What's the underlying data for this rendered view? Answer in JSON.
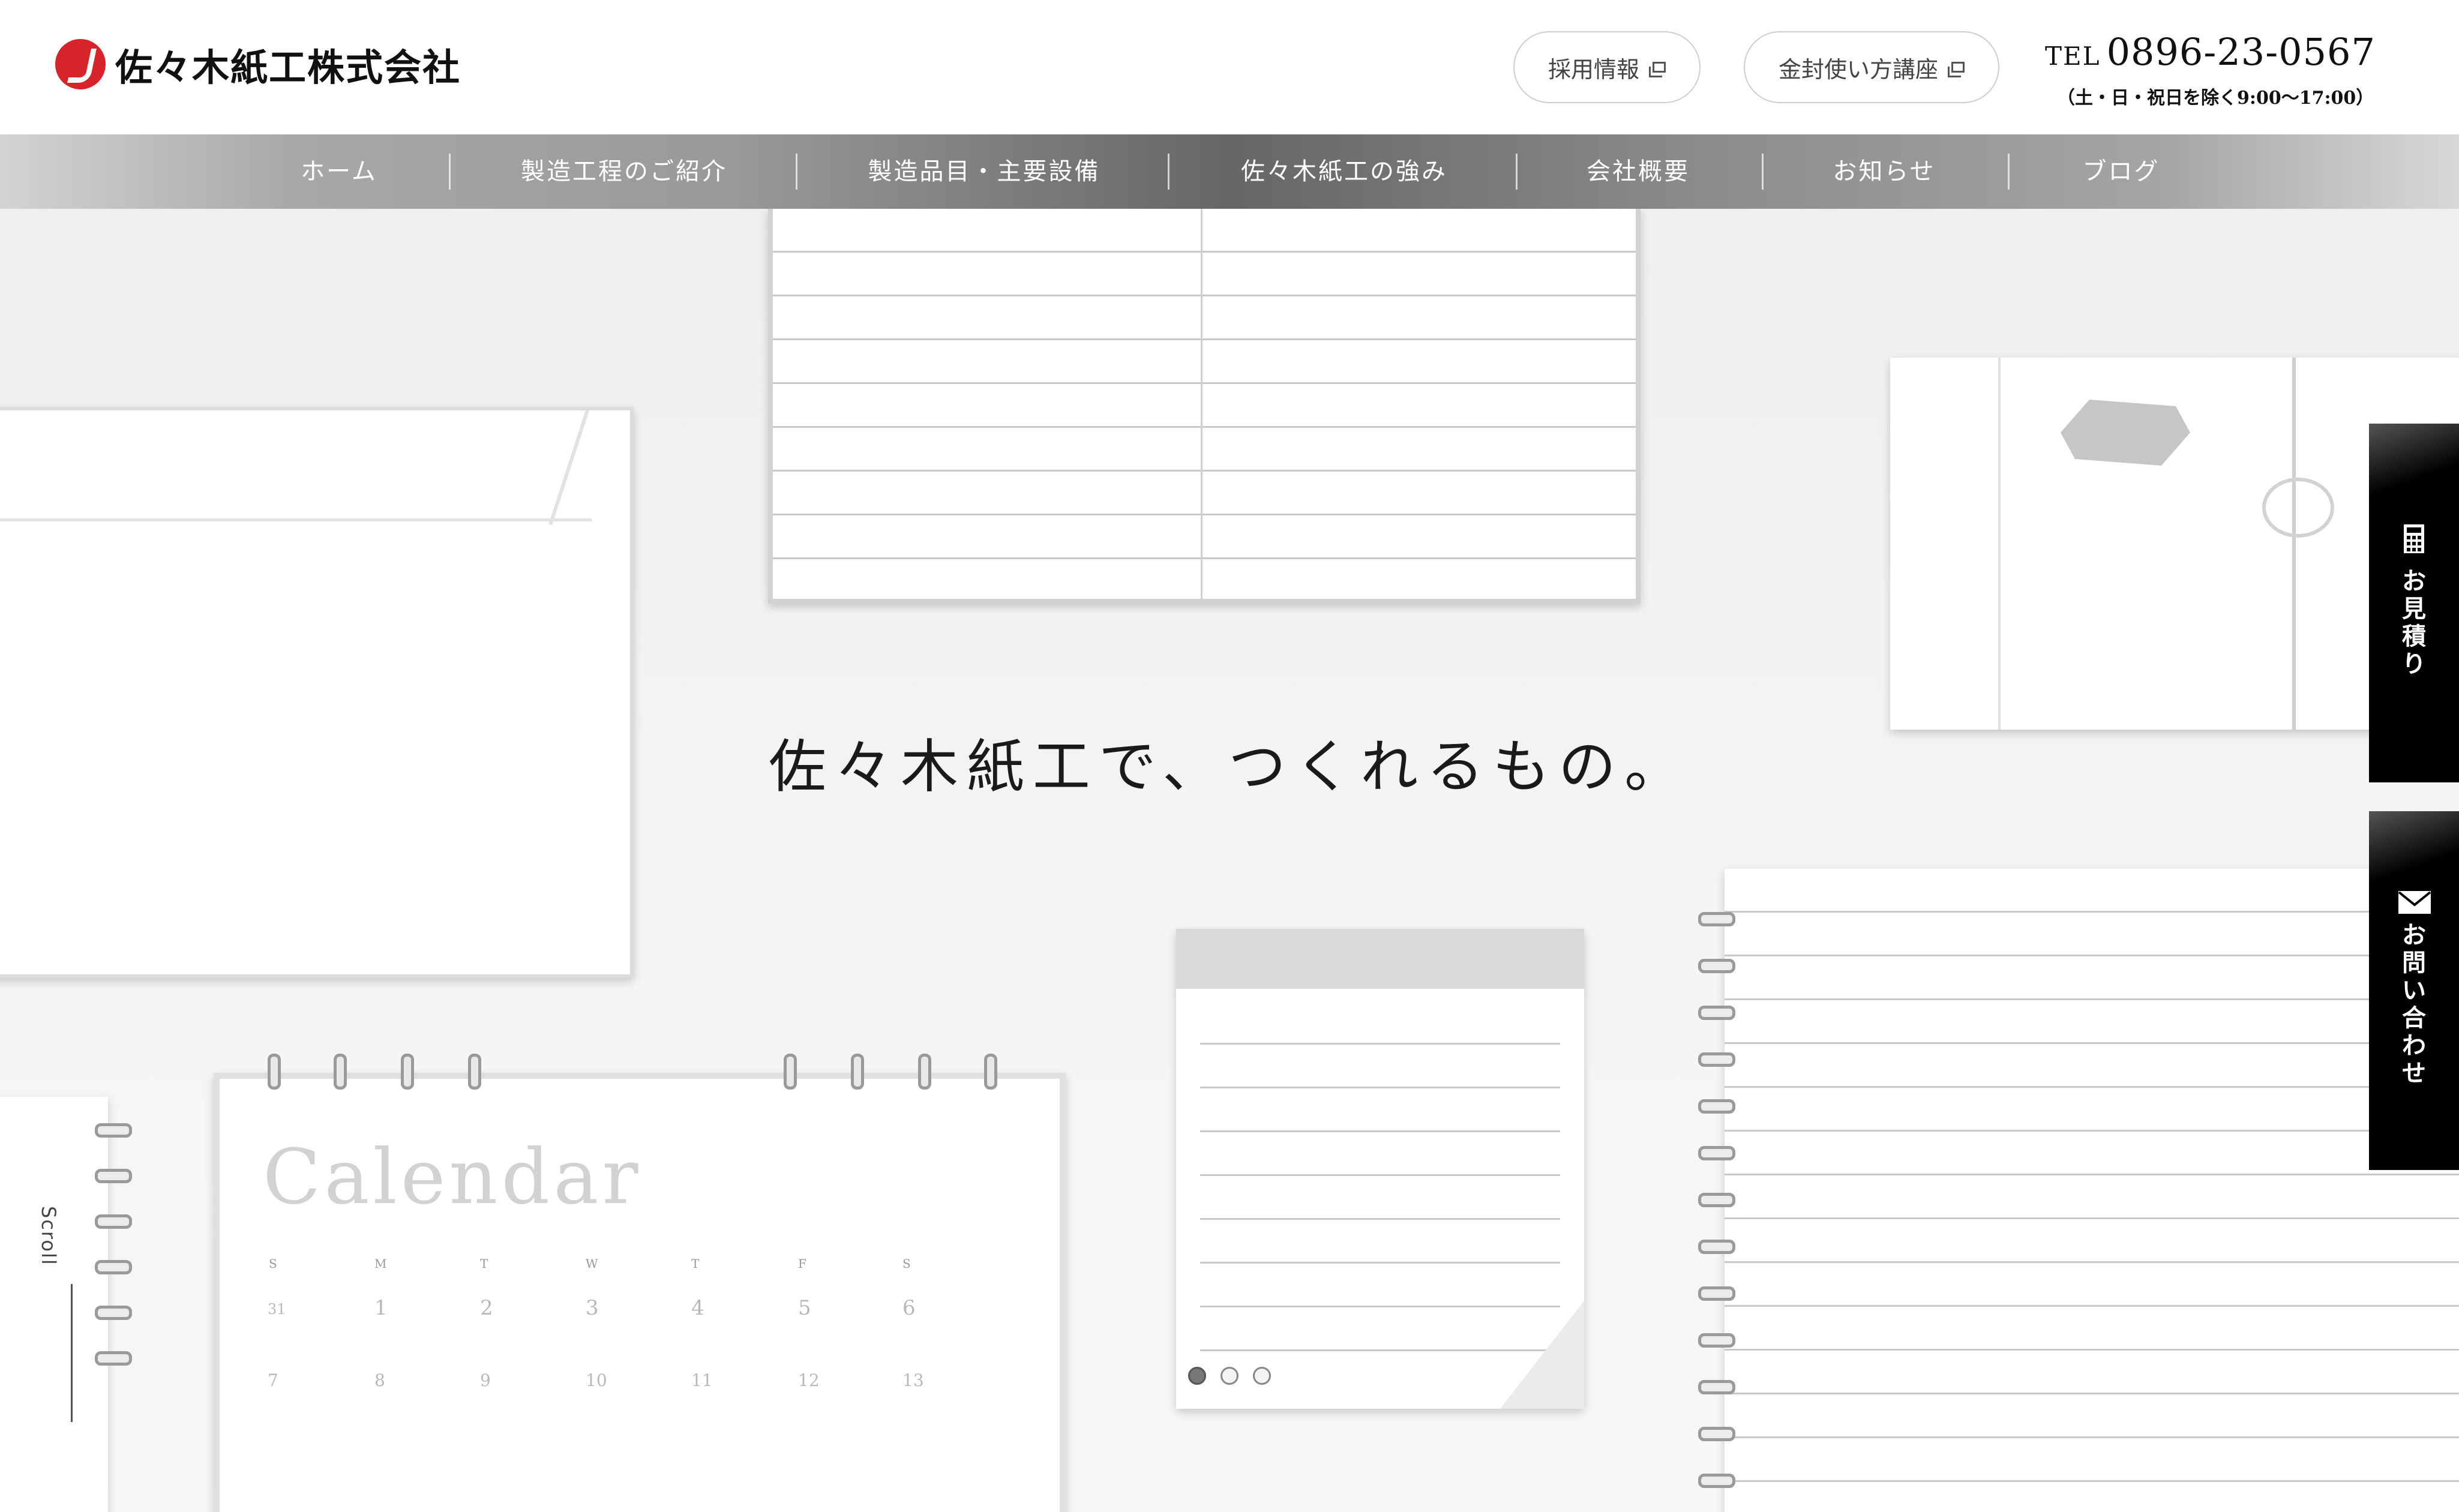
{
  "header": {
    "company_name": "佐々木紙工株式会社",
    "buttons": [
      {
        "label": "採用情報"
      },
      {
        "label": "金封使い方講座"
      }
    ],
    "tel": {
      "label": "TEL",
      "number": "0896-23-0567",
      "hours": "（土・日・祝日を除く9:00〜17:00）"
    }
  },
  "nav": {
    "items": [
      {
        "label": "ホーム"
      },
      {
        "label": "製造工程のご紹介"
      },
      {
        "label": "製造品目・主要設備"
      },
      {
        "label": "佐々木紙工の強み"
      },
      {
        "label": "会社概要"
      },
      {
        "label": "お知らせ"
      },
      {
        "label": "ブログ"
      }
    ]
  },
  "hero": {
    "catchcopy": "佐々木紙工で、つくれるもの。",
    "scroll_label": "Scroll",
    "calendar": {
      "title": "Calendar",
      "days": [
        "S",
        "M",
        "T",
        "W",
        "T",
        "F",
        "S"
      ],
      "row1": [
        "31",
        "1",
        "2",
        "3",
        "4",
        "5",
        "6"
      ],
      "row2": [
        "7",
        "8",
        "9",
        "10",
        "11",
        "12",
        "13"
      ]
    },
    "slides": {
      "count": 3,
      "active": 0
    }
  },
  "side_tabs": [
    {
      "label": "お見積り",
      "icon": "calculator-icon"
    },
    {
      "label": "お問い合わせ",
      "icon": "mail-icon"
    }
  ],
  "colors": {
    "brand": "#d8232a",
    "tab_bg": "#000000"
  }
}
